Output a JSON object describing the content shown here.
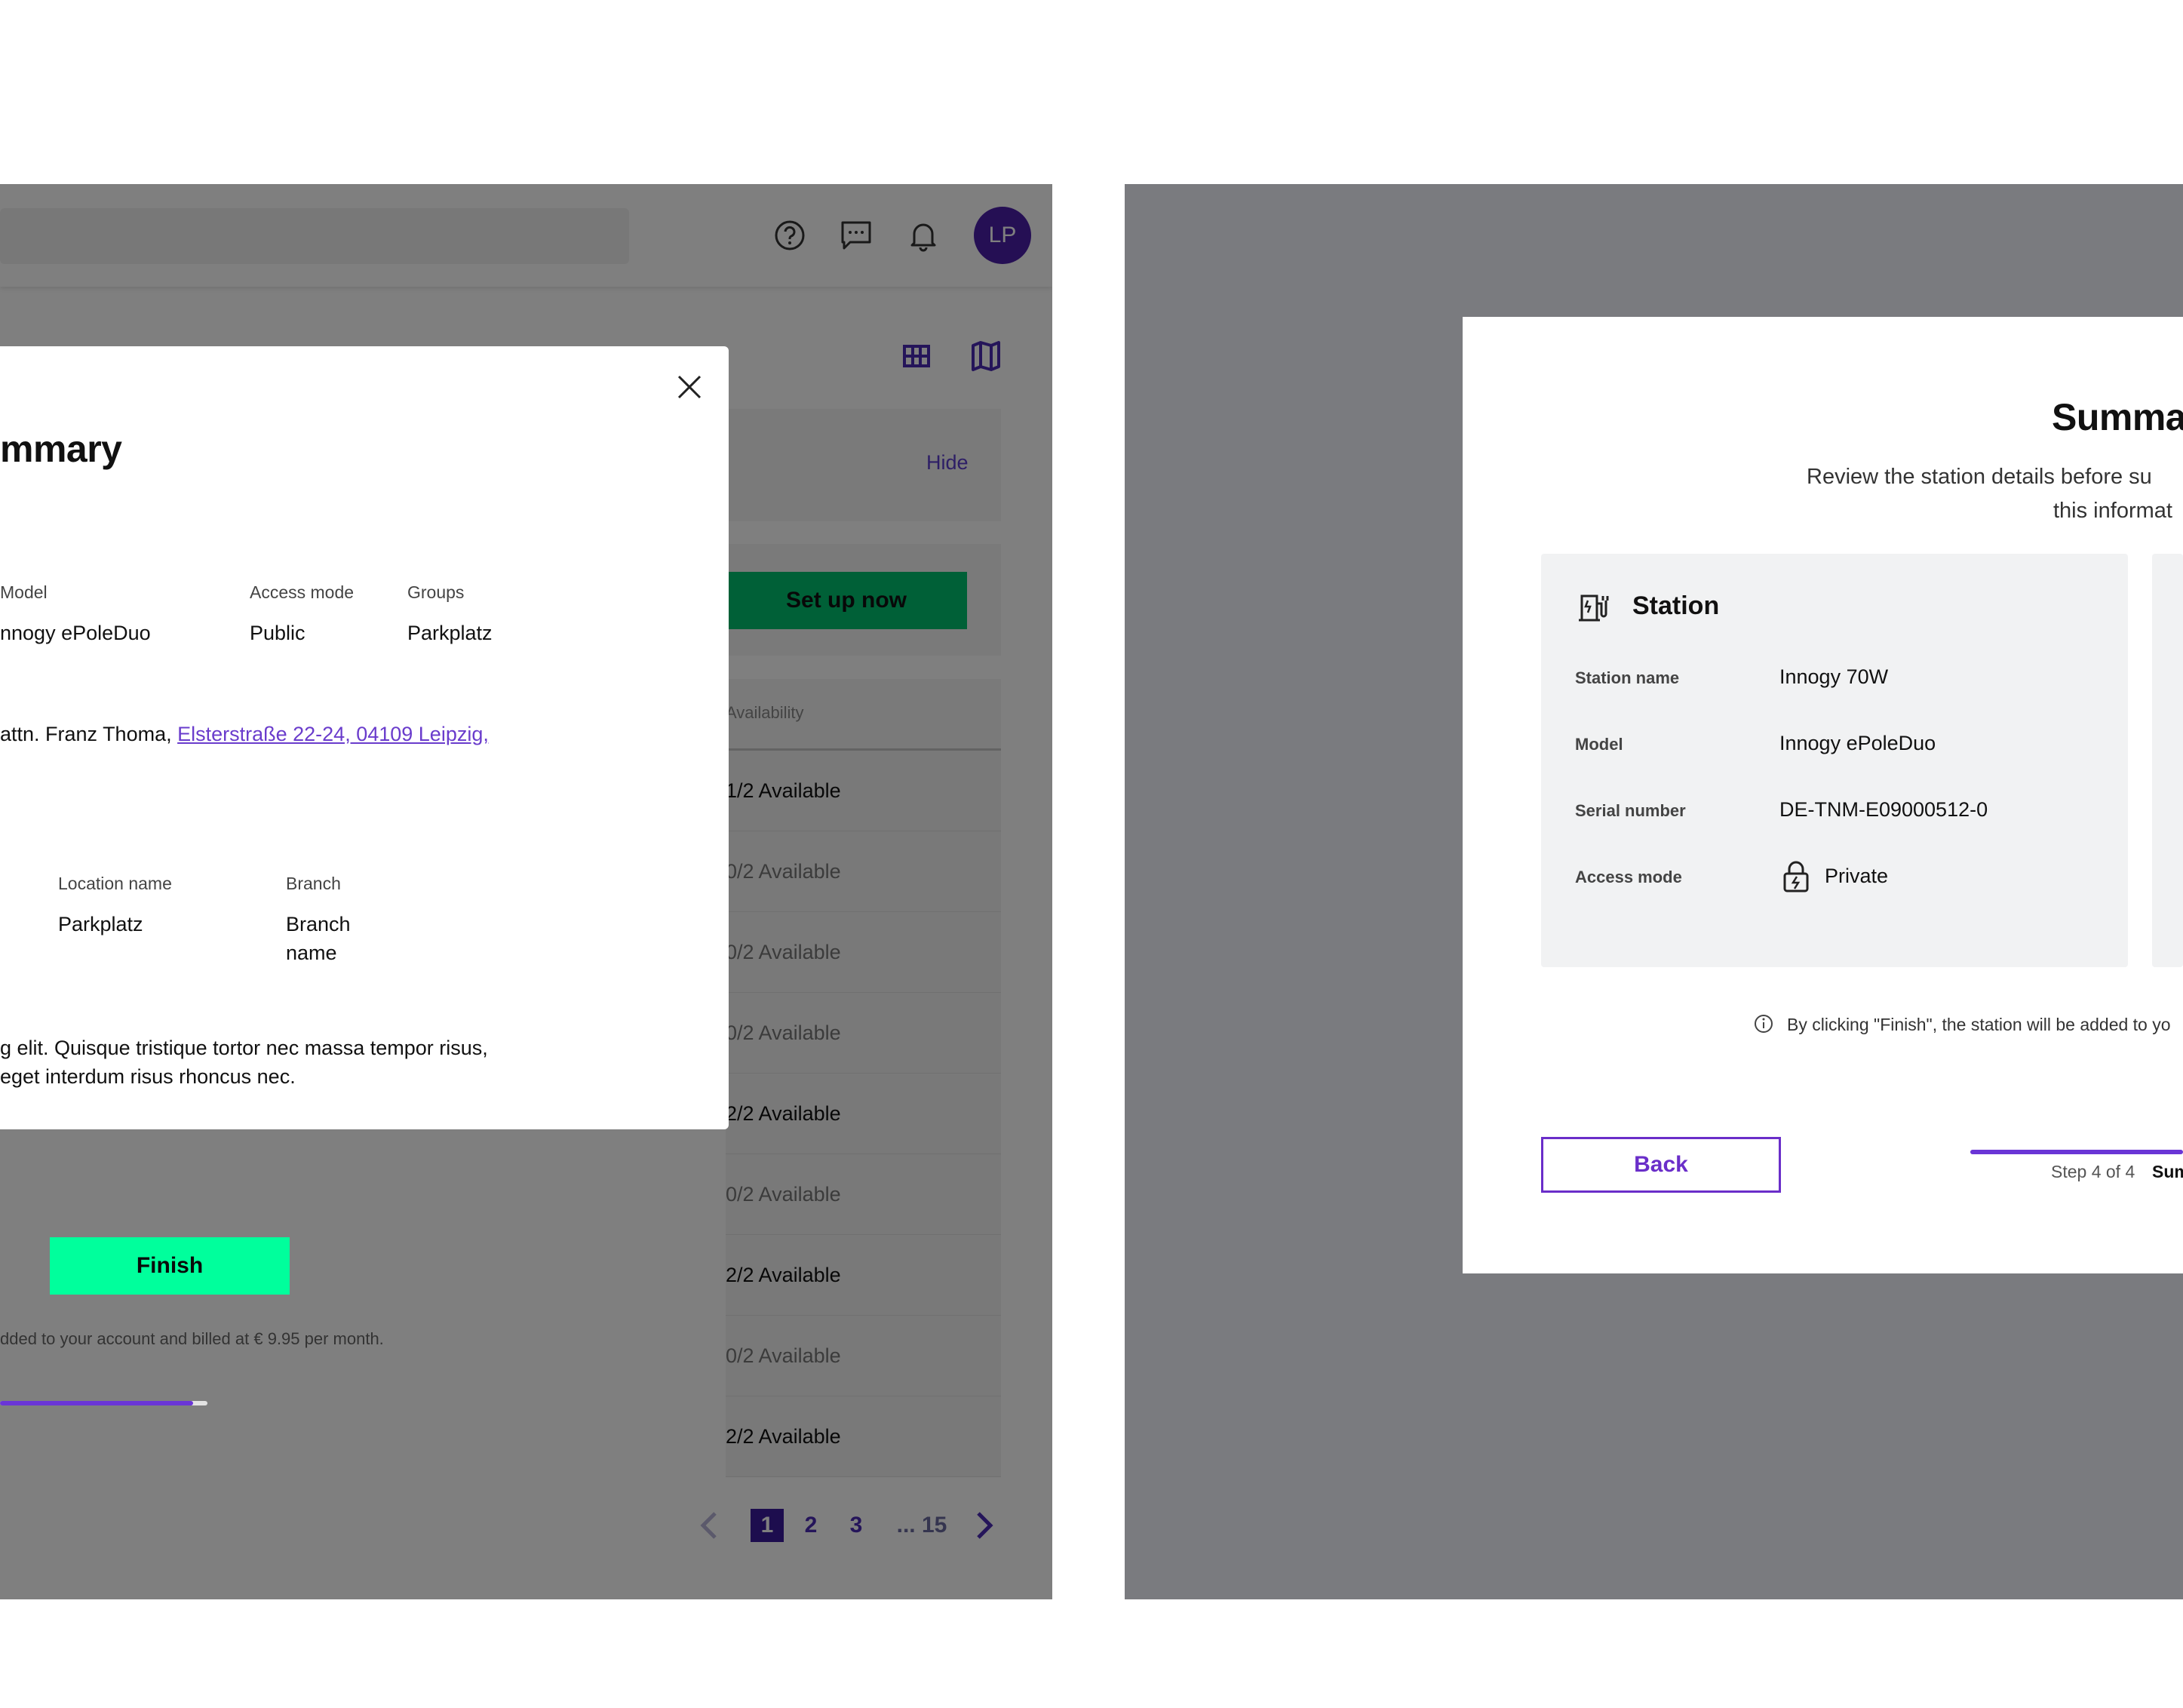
{
  "left_screen": {
    "topbar": {
      "avatar_initials": "LP",
      "icons": [
        "help-circle-icon",
        "chat-icon",
        "bell-icon"
      ]
    },
    "view_toggles": [
      "grid-view-icon",
      "map-view-icon"
    ],
    "hide_link": "Hide",
    "setup_button": "Set up now",
    "table": {
      "column_header": "Availability",
      "rows": [
        {
          "availability": "1/2 Available",
          "dim": false
        },
        {
          "availability": "0/2 Available",
          "dim": true
        },
        {
          "availability": "0/2 Available",
          "dim": true
        },
        {
          "availability": "0/2 Available",
          "dim": true
        },
        {
          "availability": "2/2 Available",
          "dim": false
        },
        {
          "availability": "0/2 Available",
          "dim": true
        },
        {
          "availability": "2/2 Available",
          "dim": false
        },
        {
          "availability": "0/2 Available",
          "dim": true
        },
        {
          "availability": "2/2 Available",
          "dim": false
        }
      ]
    },
    "pagination": {
      "pages": [
        "1",
        "2",
        "3"
      ],
      "ellipsis": "... 15",
      "current": "1"
    },
    "modal": {
      "title": "mmary",
      "model_label": "Model",
      "model_value": "nnogy ePoleDuo",
      "access_label": "Access mode",
      "access_value": "Public",
      "groups_label": "Groups",
      "groups_value": "Parkplatz",
      "address_prefix": "attn. Franz Thoma, ",
      "address_link": "Elsterstraße 22-24, 04109 Leipzig,",
      "location_label": "Location name",
      "location_value": "Parkplatz",
      "branch_label": "Branch",
      "branch_value": "Branch name",
      "description": "g elit. Quisque tristique tortor nec massa tempor risus, eget interdum risus rhoncus nec.",
      "finish_button": "Finish",
      "billing_note": "dded to your account and billed at € 9.95 per month."
    }
  },
  "right_screen": {
    "modal": {
      "title": "Summa",
      "subtitle_line1": "Review the station details before su",
      "subtitle_line2": "this informat",
      "station_card": {
        "heading": "Station",
        "fields": [
          {
            "label": "Station name",
            "value": "Innogy 70W"
          },
          {
            "label": "Model",
            "value": "Innogy ePoleDuo"
          },
          {
            "label": "Serial number",
            "value": "DE-TNM-E09000512-0"
          },
          {
            "label": "Access mode",
            "value": "Private"
          }
        ]
      },
      "info_text": "By clicking \"Finish\", the station will be added to yo",
      "back_button": "Back",
      "step_text": "Step 4 of 4",
      "step_name": "Sum"
    }
  },
  "colors": {
    "brand_purple": "#6a2ec9",
    "finish_green": "#00ff9c",
    "setup_green": "#00c16e",
    "overlay_gray": "#7a7b7f"
  }
}
